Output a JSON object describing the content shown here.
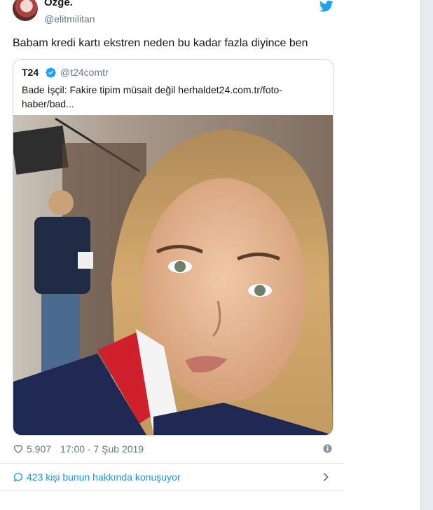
{
  "tweet": {
    "author": {
      "display_name": "Özge.",
      "handle": "@elitmilitan"
    },
    "text": "Babam kredi kartı ekstren neden bu kadar fazla diyince ben",
    "quoted_card": {
      "name": "T24",
      "handle": "@t24comtr",
      "text": "Bade İşçil: Fakire tipim müsait değil herhaldet24.com.tr/foto-haber/bad..."
    },
    "likes": "5.907",
    "timestamp": "17:00 - 7 Şub 2019",
    "conversation_label": "423 kişi bunun hakkında konuşuyor"
  },
  "icons": {
    "brand": "twitter-bird-icon",
    "verified": "verified-badge-icon",
    "like": "heart-icon",
    "info": "info-icon",
    "conversation": "speech-bubble-icon",
    "chevron": "chevron-right-icon"
  },
  "colors": {
    "twitter_blue": "#1da1f2",
    "link_blue": "#1b95e0",
    "muted_text": "#657786",
    "border": "#ccd6dd"
  }
}
